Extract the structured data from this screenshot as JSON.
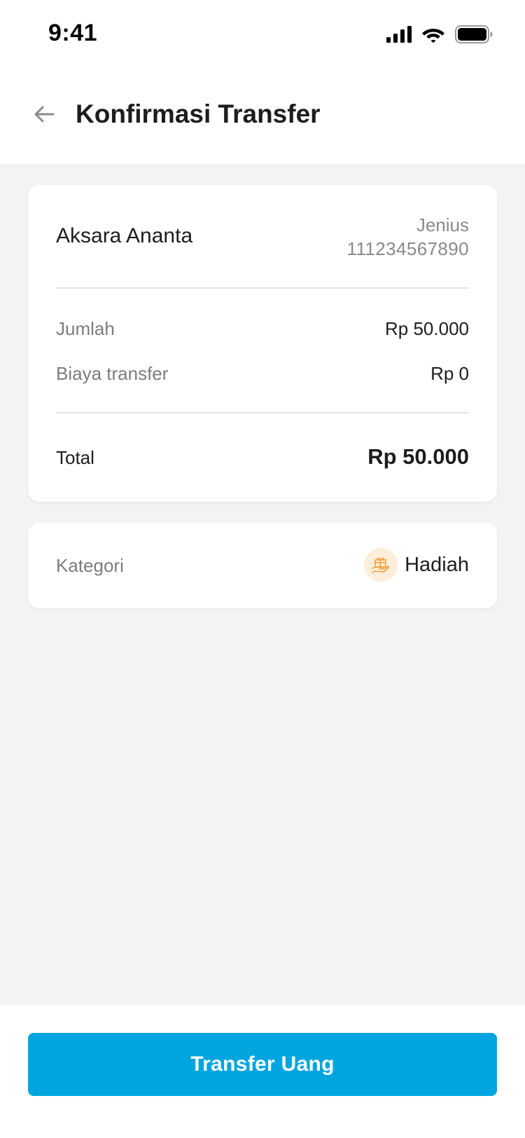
{
  "status_bar": {
    "time": "9:41"
  },
  "header": {
    "title": "Konfirmasi Transfer",
    "back_icon": "arrow-left-icon"
  },
  "recipient": {
    "name": "Aksara Ananta",
    "bank": "Jenius",
    "account_number": "111234567890"
  },
  "summary": {
    "amount_label": "Jumlah",
    "amount_value": "Rp 50.000",
    "fee_label": "Biaya transfer",
    "fee_value": "Rp 0",
    "total_label": "Total",
    "total_value": "Rp 50.000"
  },
  "category": {
    "label": "Kategori",
    "value": "Hadiah",
    "icon": "gift-icon"
  },
  "action": {
    "transfer_label": "Transfer Uang"
  },
  "colors": {
    "primary": "#00a5df",
    "background": "#f3f3f3",
    "gift_badge": "#fdeedb",
    "gift_icon": "#f0a23a"
  }
}
